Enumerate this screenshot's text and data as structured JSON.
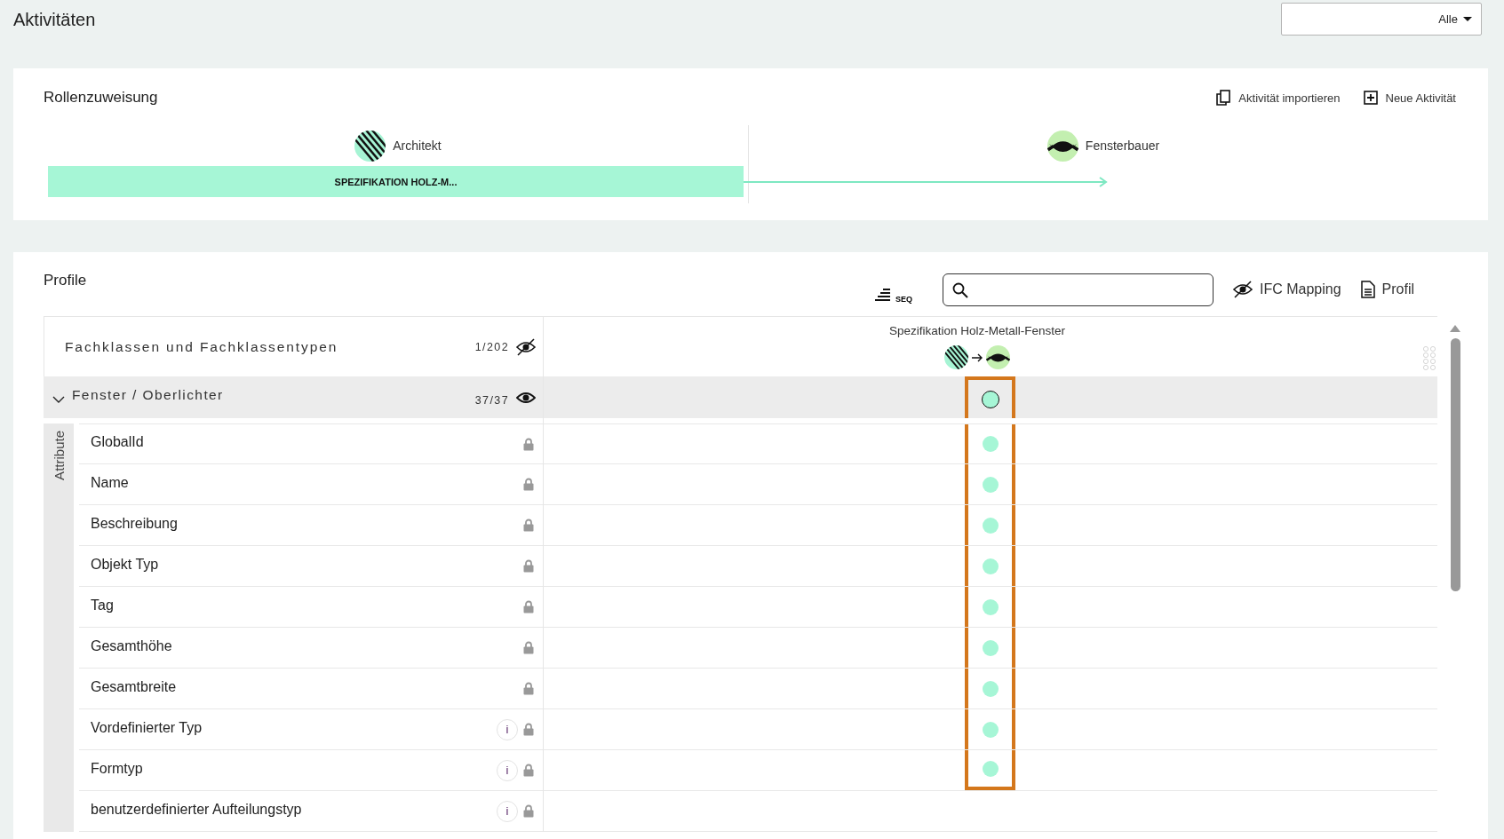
{
  "page": {
    "title": "Aktivitäten",
    "filter": {
      "value": "Alle"
    }
  },
  "role_assignment": {
    "title": "Rollenzuweisung",
    "actions": [
      {
        "label": "Aktivität importieren",
        "kind": "import"
      },
      {
        "label": "Neue Aktivität",
        "kind": "new"
      }
    ],
    "roles": [
      {
        "name": "Architekt",
        "kind": "stripes"
      },
      {
        "name": "Fensterbauer",
        "kind": "eyes"
      }
    ],
    "activities": [
      {
        "label": "SPEZIFIKATION HOLZ-M..."
      }
    ]
  },
  "profile": {
    "title": "Profile",
    "seq_label": "SEQ",
    "tools": [
      {
        "label": "IFC Mapping",
        "kind": "hidden"
      },
      {
        "label": "Profil",
        "kind": "document"
      }
    ],
    "header": {
      "title": "Fachklassen und Fachklassentypen",
      "count": "1/202",
      "visible": false
    },
    "column": {
      "title": "Spezifikation Holz-Metall-Fenster"
    },
    "group": {
      "title": "Fenster / Oberlichter",
      "count": "37/37",
      "visible": true,
      "expanded": true,
      "assigned": true,
      "highlighted": true,
      "section": "Attribute"
    },
    "rows": [
      {
        "label": "GlobalId",
        "info": false,
        "locked": true,
        "assigned": true,
        "highlighted": true
      },
      {
        "label": "Name",
        "info": false,
        "locked": true,
        "assigned": true,
        "highlighted": true
      },
      {
        "label": "Beschreibung",
        "info": false,
        "locked": true,
        "assigned": true,
        "highlighted": true
      },
      {
        "label": "Objekt Typ",
        "info": false,
        "locked": true,
        "assigned": true,
        "highlighted": true
      },
      {
        "label": "Tag",
        "info": false,
        "locked": true,
        "assigned": true,
        "highlighted": true
      },
      {
        "label": "Gesamthöhe",
        "info": false,
        "locked": true,
        "assigned": true,
        "highlighted": true
      },
      {
        "label": "Gesamtbreite",
        "info": false,
        "locked": true,
        "assigned": true,
        "highlighted": true
      },
      {
        "label": "Vordefinierter Typ",
        "info": "i",
        "locked": true,
        "assigned": true,
        "highlighted": true
      },
      {
        "label": "Formtyp",
        "info": "i",
        "locked": true,
        "assigned": true,
        "highlighted": true
      },
      {
        "label": "benutzerdefinierter Aufteilungstyp",
        "info": "i",
        "locked": true,
        "assigned": false,
        "highlighted": false
      }
    ]
  }
}
